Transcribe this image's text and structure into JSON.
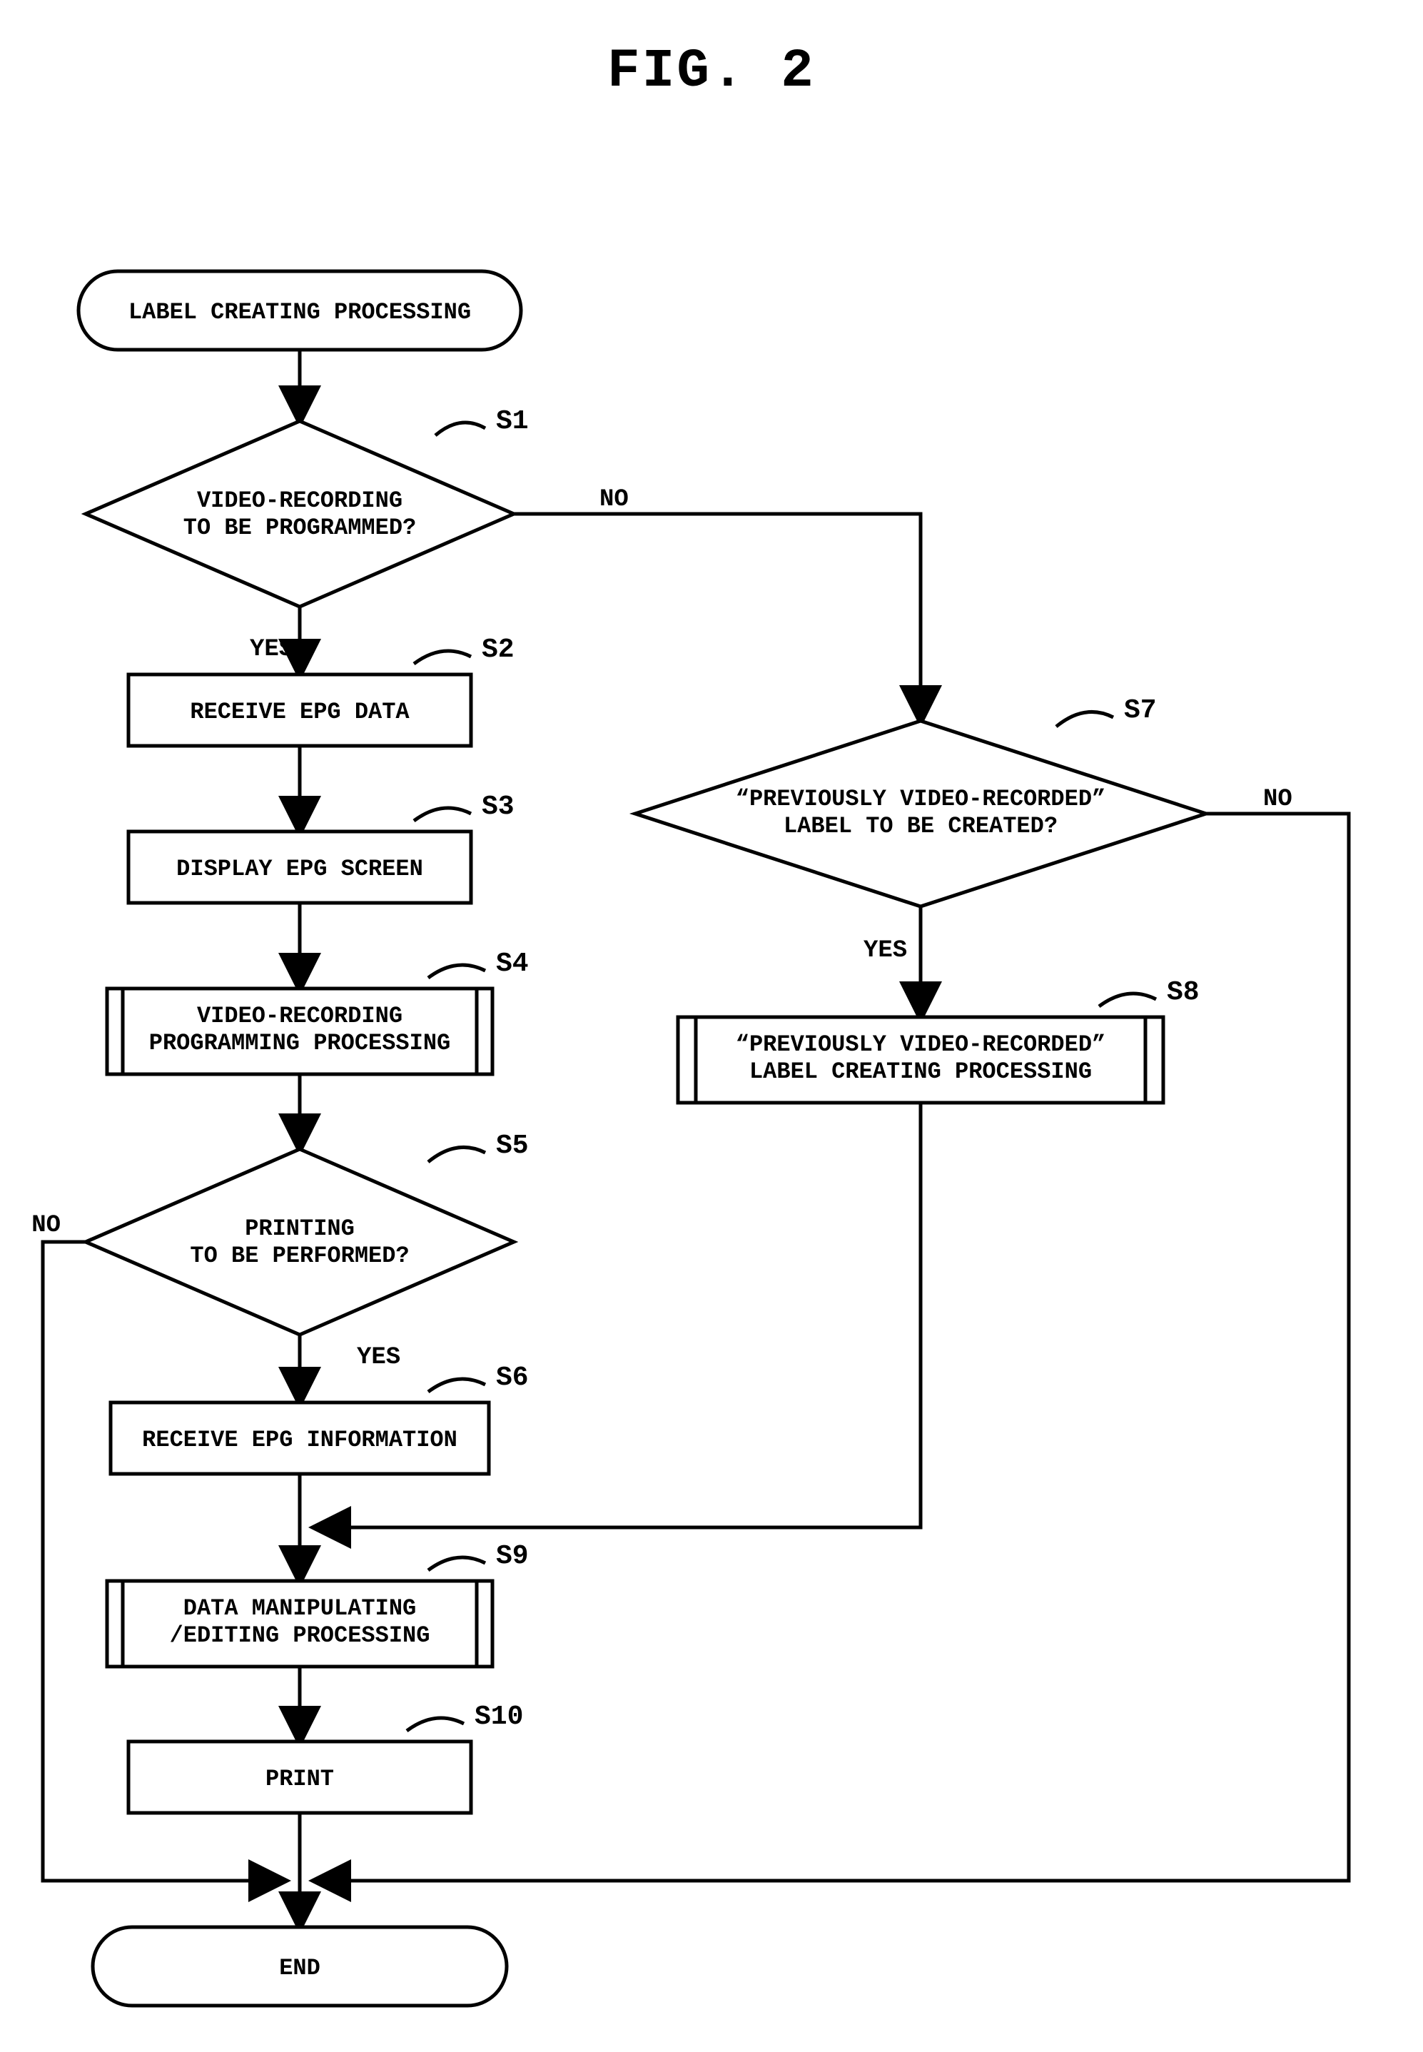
{
  "chart_data": {
    "type": "flowchart",
    "title": "FIG. 2",
    "nodes": [
      {
        "id": "start",
        "label": "LABEL CREATING PROCESSING"
      },
      {
        "id": "s1",
        "step": "S1",
        "label1": "VIDEO-RECORDING",
        "label2": "TO BE PROGRAMMED?"
      },
      {
        "id": "s2",
        "step": "S2",
        "label": "RECEIVE EPG DATA"
      },
      {
        "id": "s3",
        "step": "S3",
        "label": "DISPLAY EPG SCREEN"
      },
      {
        "id": "s4",
        "step": "S4",
        "label1": "VIDEO-RECORDING",
        "label2": "PROGRAMMING PROCESSING"
      },
      {
        "id": "s5",
        "step": "S5",
        "label1": "PRINTING",
        "label2": "TO BE PERFORMED?"
      },
      {
        "id": "s6",
        "step": "S6",
        "label": "RECEIVE EPG INFORMATION"
      },
      {
        "id": "s7",
        "step": "S7",
        "label1": "“PREVIOUSLY VIDEO-RECORDED”",
        "label2": "LABEL TO BE CREATED?"
      },
      {
        "id": "s8",
        "step": "S8",
        "label1": "“PREVIOUSLY VIDEO-RECORDED”",
        "label2": "LABEL CREATING PROCESSING"
      },
      {
        "id": "s9",
        "step": "S9",
        "label1": "DATA MANIPULATING",
        "label2": "/EDITING PROCESSING"
      },
      {
        "id": "s10",
        "step": "S10",
        "label": "PRINT"
      },
      {
        "id": "end",
        "label": "END"
      }
    ],
    "edges": {
      "yes": "YES",
      "no": "NO"
    }
  }
}
